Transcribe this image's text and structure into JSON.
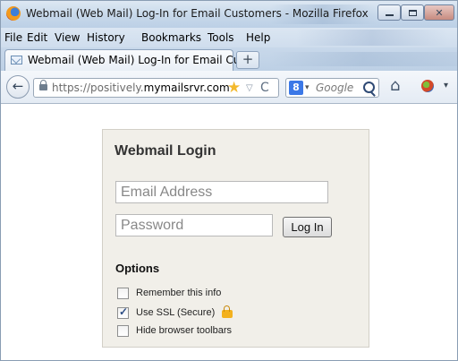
{
  "window": {
    "title": "Webmail (Web Mail) Log-In for Email Customers - Mozilla Firefox",
    "minimize_label": "",
    "close_label": "✕"
  },
  "menubar": {
    "items": [
      "File",
      "Edit",
      "View",
      "History",
      "Bookmarks",
      "Tools",
      "Help"
    ]
  },
  "tabs": [
    {
      "title": "Webmail (Web Mail) Log-In for Email Cu...",
      "active": true,
      "icon": "envelope-icon"
    }
  ],
  "new_tab_label": "+",
  "navbar": {
    "back_label": "←",
    "url_prefix": "https://positively.",
    "url_domain": "mymailsrvr.com",
    "star_glyph": "★",
    "dropdown_glyph": "▽",
    "reload_glyph": "C",
    "search_engine_glyph": "8",
    "search_caret": "▾",
    "search_placeholder": "Google",
    "home_glyph": "⌂",
    "menu_caret": "▾"
  },
  "login": {
    "title": "Webmail Login",
    "email_placeholder": "Email Address",
    "password_placeholder": "Password",
    "login_button": "Log In",
    "options_title": "Options",
    "options": [
      {
        "label": "Remember this info",
        "checked": false
      },
      {
        "label": "Use SSL (Secure)",
        "checked": true
      },
      {
        "label": "Hide browser toolbars",
        "checked": false
      }
    ]
  },
  "colors": {
    "chrome_blue": "#c7d8ea",
    "login_box_bg": "#f1efe9",
    "padlock": "#f3b11e"
  }
}
